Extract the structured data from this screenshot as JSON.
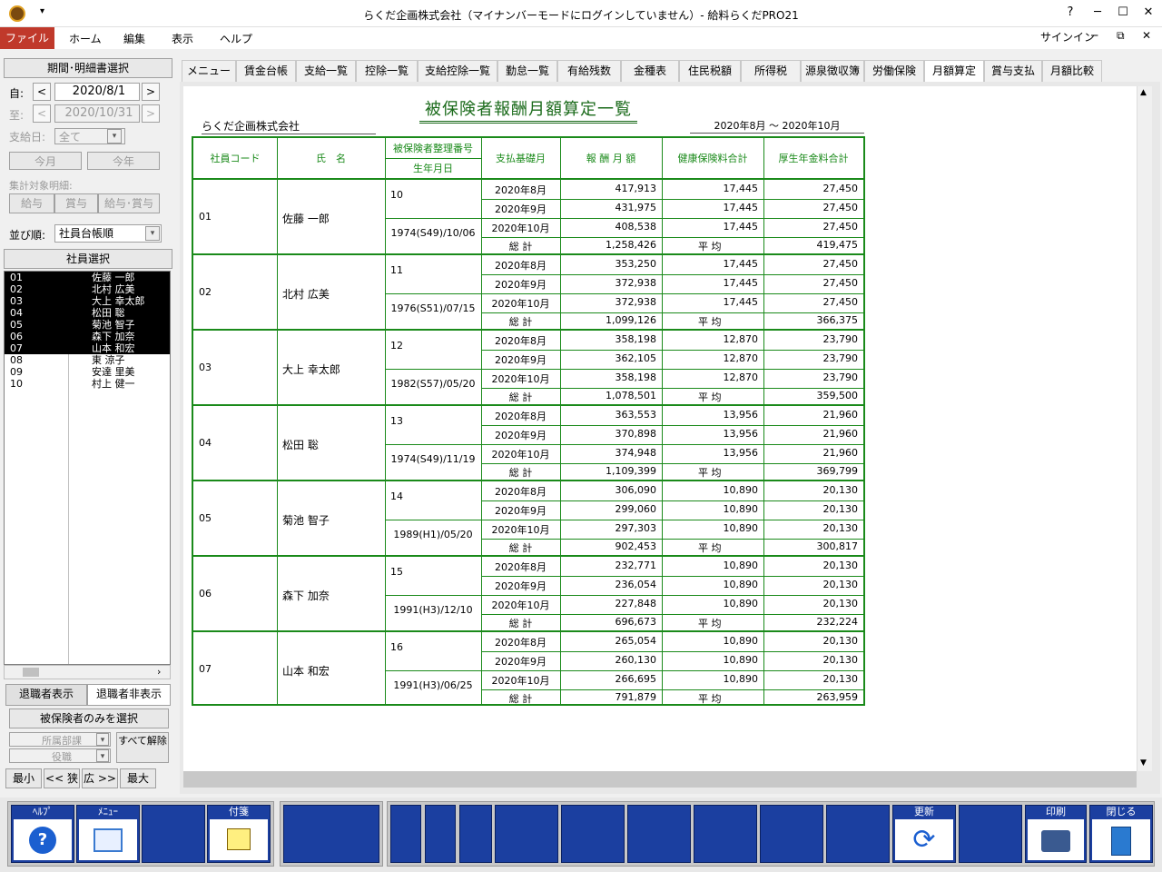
{
  "window": {
    "title": "らくだ企画株式会社（マイナンバーモードにログインしていません）- 給料らくだPRO21",
    "signin": "サインイン"
  },
  "ribbon": {
    "file": "ファイル",
    "tabs": [
      "ホーム",
      "編集",
      "表示",
      "ヘルプ"
    ]
  },
  "left": {
    "header": "期間･明細書選択",
    "from_label": "自:",
    "from_value": "2020/8/1",
    "to_label": "至:",
    "to_value": "2020/10/31",
    "payday_label": "支給日:",
    "payday_value": "全て",
    "this_month": "今月",
    "this_year": "今年",
    "target_label": "集計対象明細:",
    "target_buttons": [
      "給与",
      "賞与",
      "給与･賞与"
    ],
    "sort_label": "並び順:",
    "sort_value": "社員台帳順",
    "employee_select": "社員選択",
    "employees": [
      {
        "code": "01",
        "name": "佐藤 一郎"
      },
      {
        "code": "02",
        "name": "北村 広美"
      },
      {
        "code": "03",
        "name": "大上 幸太郎"
      },
      {
        "code": "04",
        "name": "松田 聡"
      },
      {
        "code": "05",
        "name": "菊池 智子"
      },
      {
        "code": "06",
        "name": "森下 加奈"
      },
      {
        "code": "07",
        "name": "山本 和宏"
      },
      {
        "code": "08",
        "name": "東 涼子"
      },
      {
        "code": "09",
        "name": "安達 里美"
      },
      {
        "code": "10",
        "name": "村上 健一"
      }
    ],
    "retired_show": "退職者表示",
    "retired_hide": "退職者非表示",
    "insured_only": "被保険者のみを選択",
    "dept": "所属部課",
    "role": "役職",
    "clear_all": "すべて解除",
    "size_buttons": [
      "最小",
      "<< 狭",
      "広 >>",
      "最大"
    ]
  },
  "tabs": [
    "メニュー",
    "賃金台帳",
    "支給一覧",
    "控除一覧",
    "支給控除一覧",
    "勤怠一覧",
    "有給残数",
    "金種表",
    "住民税額",
    "所得税",
    "源泉徴収簿",
    "労働保険",
    "月額算定",
    "賞与支払",
    "月額比較"
  ],
  "active_tab": "月額算定",
  "report": {
    "title": "被保険者報酬月額算定一覧",
    "company": "らくだ企画株式会社",
    "period": "2020年8月 ～ 2020年10月",
    "headers": {
      "code": "社員コード",
      "name": "氏　名",
      "insno": "被保険者整理番号",
      "birth": "生年月日",
      "base": "支払基礎月",
      "pay": "報 酬 月 額",
      "health": "健康保険料合計",
      "pension": "厚生年金料合計"
    },
    "total_label": "総 計",
    "avg_label": "平 均",
    "rows": [
      {
        "code": "01",
        "name": "佐藤 一郎",
        "insno": "10",
        "birth": "1974(S49)/10/06",
        "months": [
          [
            "2020年8月",
            "417,913",
            "17,445",
            "27,450"
          ],
          [
            "2020年9月",
            "431,975",
            "17,445",
            "27,450"
          ],
          [
            "2020年10月",
            "408,538",
            "17,445",
            "27,450"
          ]
        ],
        "total": "1,258,426",
        "avg": "419,475"
      },
      {
        "code": "02",
        "name": "北村 広美",
        "insno": "11",
        "birth": "1976(S51)/07/15",
        "months": [
          [
            "2020年8月",
            "353,250",
            "17,445",
            "27,450"
          ],
          [
            "2020年9月",
            "372,938",
            "17,445",
            "27,450"
          ],
          [
            "2020年10月",
            "372,938",
            "17,445",
            "27,450"
          ]
        ],
        "total": "1,099,126",
        "avg": "366,375"
      },
      {
        "code": "03",
        "name": "大上 幸太郎",
        "insno": "12",
        "birth": "1982(S57)/05/20",
        "months": [
          [
            "2020年8月",
            "358,198",
            "12,870",
            "23,790"
          ],
          [
            "2020年9月",
            "362,105",
            "12,870",
            "23,790"
          ],
          [
            "2020年10月",
            "358,198",
            "12,870",
            "23,790"
          ]
        ],
        "total": "1,078,501",
        "avg": "359,500"
      },
      {
        "code": "04",
        "name": "松田 聡",
        "insno": "13",
        "birth": "1974(S49)/11/19",
        "months": [
          [
            "2020年8月",
            "363,553",
            "13,956",
            "21,960"
          ],
          [
            "2020年9月",
            "370,898",
            "13,956",
            "21,960"
          ],
          [
            "2020年10月",
            "374,948",
            "13,956",
            "21,960"
          ]
        ],
        "total": "1,109,399",
        "avg": "369,799"
      },
      {
        "code": "05",
        "name": "菊池 智子",
        "insno": "14",
        "birth": "1989(H1)/05/20",
        "months": [
          [
            "2020年8月",
            "306,090",
            "10,890",
            "20,130"
          ],
          [
            "2020年9月",
            "299,060",
            "10,890",
            "20,130"
          ],
          [
            "2020年10月",
            "297,303",
            "10,890",
            "20,130"
          ]
        ],
        "total": "902,453",
        "avg": "300,817"
      },
      {
        "code": "06",
        "name": "森下 加奈",
        "insno": "15",
        "birth": "1991(H3)/12/10",
        "months": [
          [
            "2020年8月",
            "232,771",
            "10,890",
            "20,130"
          ],
          [
            "2020年9月",
            "236,054",
            "10,890",
            "20,130"
          ],
          [
            "2020年10月",
            "227,848",
            "10,890",
            "20,130"
          ]
        ],
        "total": "696,673",
        "avg": "232,224"
      },
      {
        "code": "07",
        "name": "山本 和宏",
        "insno": "16",
        "birth": "1991(H3)/06/25",
        "months": [
          [
            "2020年8月",
            "265,054",
            "10,890",
            "20,130"
          ],
          [
            "2020年9月",
            "260,130",
            "10,890",
            "20,130"
          ],
          [
            "2020年10月",
            "266,695",
            "10,890",
            "20,130"
          ]
        ],
        "total": "791,879",
        "avg": "263,959"
      }
    ]
  },
  "toolbar": {
    "help": "ﾍﾙﾌﾟ",
    "menu": "ﾒﾆｭｰ",
    "sticky": "付箋",
    "refresh": "更新",
    "print": "印刷",
    "close": "閉じる"
  }
}
